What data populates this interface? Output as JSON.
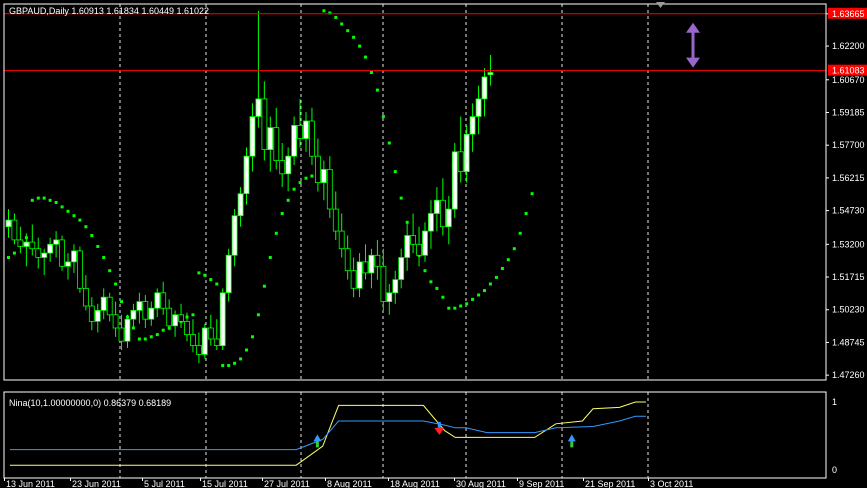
{
  "main_header": {
    "symbol": "GBPAUD,Daily",
    "ohlc": "1.60913 1.61834 1.60449 1.61022"
  },
  "indicator_header": "Nina(10,1.00000000,0) 0.86379 0.68189",
  "colors": {
    "background": "#000000",
    "frame": "#ffffff",
    "bull_candle": "#ffffff",
    "bear_candle": "#000000",
    "wick": "#00ff00",
    "psar": "#00ff00",
    "hline": "#ff0000",
    "price_tag": "#ff0000",
    "arrow": "#9966cc",
    "ind_yellow": "#ffff66",
    "ind_blue": "#3399ff",
    "up_arrow": "#33cc33",
    "down_arrow": "#ff2222"
  },
  "chart_data": {
    "type": "candlestick",
    "price_axis_ticks": [
      "1.63665",
      "1.62200",
      "1.60670",
      "1.59185",
      "1.57700",
      "1.56215",
      "1.54730",
      "1.53200",
      "1.51715",
      "1.50230",
      "1.48745",
      "1.47260"
    ],
    "price_tags": [
      "1.63665",
      "1.61083"
    ],
    "hlines": [
      1.63665,
      1.61083
    ],
    "ylim": [
      1.4704,
      1.6411
    ],
    "date_labels": [
      "13 Jun 2011",
      "23 Jun 2011",
      "5 Jul 2011",
      "15 Jul 2011",
      "27 Jul 2011",
      "8 Aug 2011",
      "18 Aug 2011",
      "30 Aug 2011",
      "9 Sep 2011",
      "21 Sep 2011",
      "3 Oct 2011"
    ],
    "candles": [
      [
        1.54,
        1.548,
        1.535,
        1.543
      ],
      [
        1.543,
        1.546,
        1.532,
        1.534
      ],
      [
        1.534,
        1.54,
        1.528,
        1.531
      ],
      [
        1.531,
        1.537,
        1.522,
        1.533
      ],
      [
        1.533,
        1.541,
        1.527,
        1.53
      ],
      [
        1.53,
        1.535,
        1.521,
        1.526
      ],
      [
        1.526,
        1.53,
        1.518,
        1.528
      ],
      [
        1.528,
        1.535,
        1.524,
        1.532
      ],
      [
        1.532,
        1.538,
        1.526,
        1.534
      ],
      [
        1.534,
        1.536,
        1.52,
        1.522
      ],
      [
        1.522,
        1.528,
        1.516,
        1.524
      ],
      [
        1.524,
        1.532,
        1.519,
        1.529
      ],
      [
        1.529,
        1.531,
        1.51,
        1.512
      ],
      [
        1.512,
        1.518,
        1.502,
        1.504
      ],
      [
        1.504,
        1.508,
        1.493,
        1.497
      ],
      [
        1.497,
        1.505,
        1.492,
        1.502
      ],
      [
        1.502,
        1.512,
        1.498,
        1.508
      ],
      [
        1.508,
        1.51,
        1.497,
        1.5
      ],
      [
        1.5,
        1.506,
        1.49,
        1.494
      ],
      [
        1.494,
        1.5,
        1.484,
        1.488
      ],
      [
        1.488,
        1.5,
        1.485,
        1.498
      ],
      [
        1.498,
        1.505,
        1.494,
        1.502
      ],
      [
        1.502,
        1.51,
        1.496,
        1.506
      ],
      [
        1.506,
        1.509,
        1.494,
        1.498
      ],
      [
        1.498,
        1.506,
        1.495,
        1.503
      ],
      [
        1.503,
        1.512,
        1.499,
        1.51
      ],
      [
        1.51,
        1.515,
        1.5,
        1.503
      ],
      [
        1.503,
        1.507,
        1.493,
        1.495
      ],
      [
        1.495,
        1.502,
        1.49,
        1.5
      ],
      [
        1.5,
        1.505,
        1.494,
        1.497
      ],
      [
        1.497,
        1.501,
        1.488,
        1.491
      ],
      [
        1.491,
        1.498,
        1.483,
        1.486
      ],
      [
        1.486,
        1.492,
        1.478,
        1.482
      ],
      [
        1.482,
        1.496,
        1.48,
        1.494
      ],
      [
        1.494,
        1.5,
        1.486,
        1.489
      ],
      [
        1.489,
        1.498,
        1.484,
        1.486
      ],
      [
        1.486,
        1.512,
        1.484,
        1.51
      ],
      [
        1.51,
        1.53,
        1.506,
        1.527
      ],
      [
        1.527,
        1.548,
        1.522,
        1.545
      ],
      [
        1.545,
        1.558,
        1.54,
        1.555
      ],
      [
        1.555,
        1.576,
        1.55,
        1.572
      ],
      [
        1.572,
        1.596,
        1.565,
        1.59
      ],
      [
        1.59,
        1.638,
        1.585,
        1.598
      ],
      [
        1.598,
        1.606,
        1.57,
        1.575
      ],
      [
        1.575,
        1.59,
        1.565,
        1.585
      ],
      [
        1.585,
        1.594,
        1.566,
        1.57
      ],
      [
        1.57,
        1.578,
        1.558,
        1.564
      ],
      [
        1.564,
        1.576,
        1.556,
        1.572
      ],
      [
        1.572,
        1.59,
        1.568,
        1.586
      ],
      [
        1.586,
        1.598,
        1.576,
        1.58
      ],
      [
        1.58,
        1.592,
        1.574,
        1.588
      ],
      [
        1.588,
        1.594,
        1.568,
        1.572
      ],
      [
        1.572,
        1.58,
        1.556,
        1.56
      ],
      [
        1.56,
        1.57,
        1.552,
        1.566
      ],
      [
        1.566,
        1.572,
        1.544,
        1.548
      ],
      [
        1.548,
        1.556,
        1.534,
        1.538
      ],
      [
        1.538,
        1.546,
        1.526,
        1.53
      ],
      [
        1.53,
        1.536,
        1.516,
        1.52
      ],
      [
        1.52,
        1.526,
        1.508,
        1.512
      ],
      [
        1.512,
        1.528,
        1.508,
        1.524
      ],
      [
        1.524,
        1.532,
        1.516,
        1.519
      ],
      [
        1.519,
        1.53,
        1.512,
        1.527
      ],
      [
        1.527,
        1.534,
        1.516,
        1.522
      ],
      [
        1.522,
        1.53,
        1.502,
        1.506
      ],
      [
        1.506,
        1.514,
        1.5,
        1.51
      ],
      [
        1.51,
        1.52,
        1.505,
        1.516
      ],
      [
        1.516,
        1.53,
        1.512,
        1.526
      ],
      [
        1.526,
        1.542,
        1.52,
        1.536
      ],
      [
        1.536,
        1.546,
        1.528,
        1.532
      ],
      [
        1.532,
        1.54,
        1.522,
        1.527
      ],
      [
        1.527,
        1.542,
        1.524,
        1.538
      ],
      [
        1.538,
        1.552,
        1.53,
        1.546
      ],
      [
        1.546,
        1.558,
        1.538,
        1.552
      ],
      [
        1.552,
        1.562,
        1.536,
        1.54
      ],
      [
        1.54,
        1.554,
        1.532,
        1.548
      ],
      [
        1.548,
        1.578,
        1.544,
        1.574
      ],
      [
        1.574,
        1.59,
        1.56,
        1.565
      ],
      [
        1.565,
        1.586,
        1.56,
        1.582
      ],
      [
        1.582,
        1.596,
        1.574,
        1.59
      ],
      [
        1.59,
        1.604,
        1.582,
        1.598
      ],
      [
        1.598,
        1.612,
        1.59,
        1.608
      ],
      [
        1.609,
        1.618,
        1.604,
        1.61
      ]
    ],
    "psar": [
      [
        0,
        1.526
      ],
      [
        1,
        1.528
      ],
      [
        2,
        1.532
      ],
      [
        3,
        1.535
      ],
      [
        4,
        1.552
      ],
      [
        5,
        1.553
      ],
      [
        6,
        1.553
      ],
      [
        7,
        1.552
      ],
      [
        8,
        1.551
      ],
      [
        9,
        1.549
      ],
      [
        10,
        1.547
      ],
      [
        11,
        1.545
      ],
      [
        12,
        1.543
      ],
      [
        13,
        1.54
      ],
      [
        14,
        1.536
      ],
      [
        15,
        1.531
      ],
      [
        16,
        1.526
      ],
      [
        17,
        1.52
      ],
      [
        18,
        1.514
      ],
      [
        19,
        1.506
      ],
      [
        20,
        1.499
      ],
      [
        21,
        1.494
      ],
      [
        22,
        1.489
      ],
      [
        23,
        1.489
      ],
      [
        24,
        1.49
      ],
      [
        25,
        1.491
      ],
      [
        26,
        1.493
      ],
      [
        27,
        1.494
      ],
      [
        28,
        1.496
      ],
      [
        29,
        1.497
      ],
      [
        30,
        1.499
      ],
      [
        31,
        1.5
      ],
      [
        32,
        1.519
      ],
      [
        33,
        1.518
      ],
      [
        34,
        1.516
      ],
      [
        35,
        1.514
      ],
      [
        36,
        1.477
      ],
      [
        37,
        1.477
      ],
      [
        38,
        1.478
      ],
      [
        39,
        1.48
      ],
      [
        40,
        1.484
      ],
      [
        41,
        1.49
      ],
      [
        42,
        1.5
      ],
      [
        43,
        1.513
      ],
      [
        44,
        1.526
      ],
      [
        45,
        1.537
      ],
      [
        46,
        1.546
      ],
      [
        47,
        1.552
      ],
      [
        48,
        1.557
      ],
      [
        49,
        1.56
      ],
      [
        50,
        1.562
      ],
      [
        51,
        1.563
      ],
      [
        52,
        1.564
      ],
      [
        53,
        1.638
      ],
      [
        54,
        1.637
      ],
      [
        55,
        1.635
      ],
      [
        56,
        1.632
      ],
      [
        57,
        1.629
      ],
      [
        58,
        1.626
      ],
      [
        59,
        1.622
      ],
      [
        60,
        1.617
      ],
      [
        61,
        1.61
      ],
      [
        62,
        1.602
      ],
      [
        63,
        1.59
      ],
      [
        64,
        1.578
      ],
      [
        65,
        1.565
      ],
      [
        66,
        1.553
      ],
      [
        67,
        1.542
      ],
      [
        68,
        1.534
      ],
      [
        69,
        1.527
      ],
      [
        70,
        1.52
      ],
      [
        71,
        1.515
      ],
      [
        72,
        1.512
      ],
      [
        73,
        1.508
      ],
      [
        74,
        1.503
      ],
      [
        75,
        1.503
      ],
      [
        76,
        1.504
      ],
      [
        77,
        1.505
      ],
      [
        78,
        1.507
      ],
      [
        79,
        1.509
      ],
      [
        80,
        1.511
      ],
      [
        81,
        1.514
      ],
      [
        82,
        1.517
      ],
      [
        83,
        1.521
      ],
      [
        84,
        1.525
      ],
      [
        85,
        1.53
      ],
      [
        86,
        1.537
      ],
      [
        87,
        1.546
      ],
      [
        88,
        1.555
      ]
    ],
    "indicator": {
      "ylim": [
        0,
        1
      ],
      "ticks": [
        "1",
        "0"
      ],
      "yellow": [
        [
          0,
          0.07
        ],
        [
          54,
          0.07
        ],
        [
          59,
          0.35
        ],
        [
          62,
          0.95
        ],
        [
          78,
          0.95
        ],
        [
          82,
          0.58
        ],
        [
          84,
          0.48
        ],
        [
          99,
          0.48
        ],
        [
          103,
          0.68
        ],
        [
          108,
          0.72
        ],
        [
          110,
          0.9
        ],
        [
          115,
          0.92
        ],
        [
          118,
          1.0
        ],
        [
          120,
          1.0
        ]
      ],
      "blue": [
        [
          0,
          0.3
        ],
        [
          54,
          0.3
        ],
        [
          59,
          0.45
        ],
        [
          62,
          0.72
        ],
        [
          78,
          0.72
        ],
        [
          82,
          0.66
        ],
        [
          84,
          0.62
        ],
        [
          86,
          0.62
        ],
        [
          90,
          0.55
        ],
        [
          99,
          0.55
        ],
        [
          103,
          0.62
        ],
        [
          110,
          0.64
        ],
        [
          115,
          0.72
        ],
        [
          118,
          0.79
        ],
        [
          120,
          0.79
        ]
      ],
      "up_arrows": [
        58,
        106
      ],
      "down_arrows": [
        81
      ]
    }
  }
}
